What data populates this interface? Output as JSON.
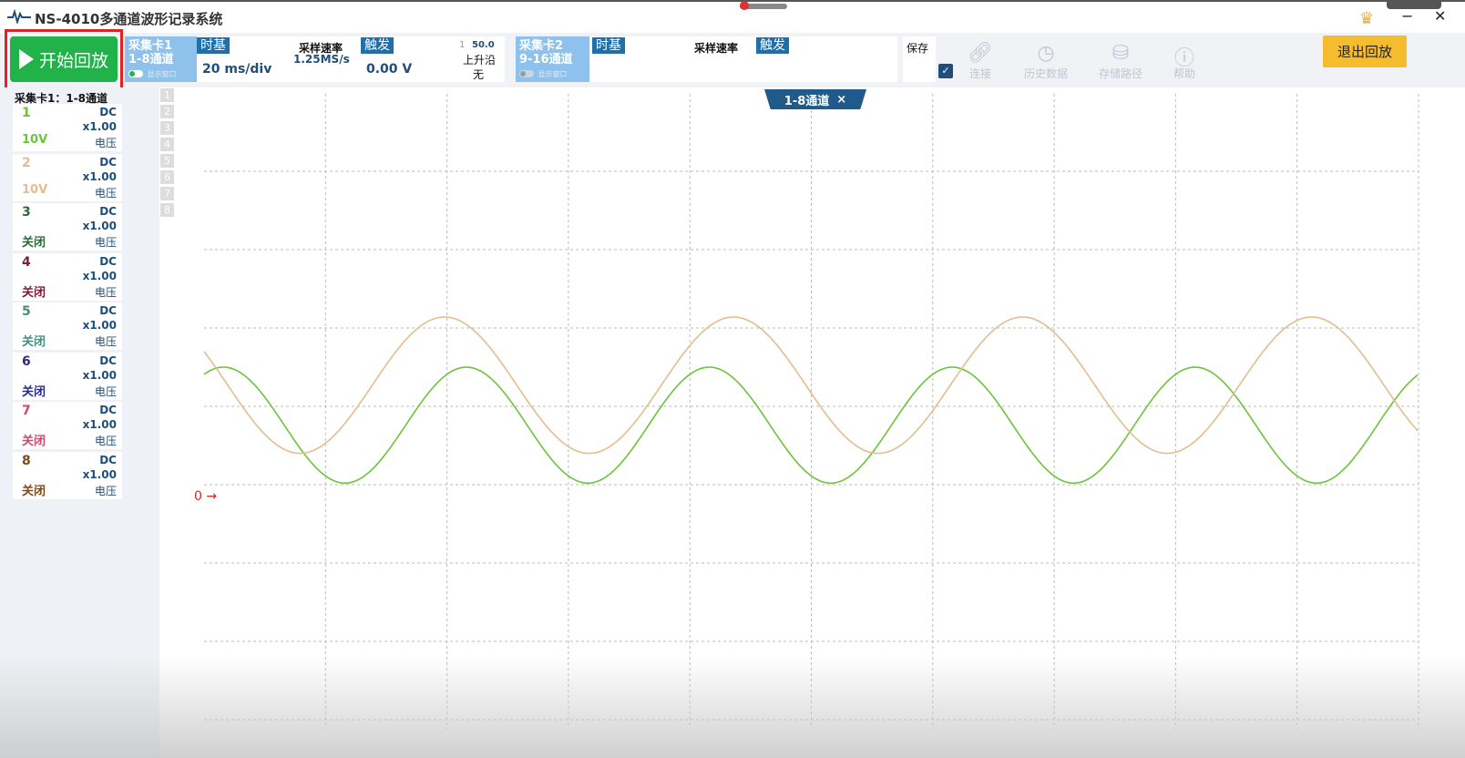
{
  "app": {
    "title": "NS-4010多通道波形记录系统"
  },
  "toolbar": {
    "play_label": "开始回放",
    "card1": {
      "name": "采集卡1",
      "channels": "1-8通道",
      "toggle_label": "显示窗口",
      "timebase_tag": "时基",
      "timebase_value": "20 ms/div",
      "sample_rate_label": "采样速率",
      "sample_rate_value": "1.25MS/s",
      "trigger_tag": "触发",
      "trigger_value": "0.00 V",
      "trigger_channel": "1",
      "trigger_level": "50.0",
      "trigger_edge": "上升沿",
      "trigger_mode": "无"
    },
    "card2": {
      "name": "采集卡2",
      "channels": "9-16通道",
      "toggle_label": "显示窗口",
      "timebase_tag": "时基",
      "sample_rate_label": "采样速率",
      "trigger_tag": "触发"
    },
    "save_label": "保存",
    "save_checked": true,
    "tools": [
      {
        "label": "连接",
        "icon": "link-icon"
      },
      {
        "label": "历史数据",
        "icon": "history-icon"
      },
      {
        "label": "存储路径",
        "icon": "storage-icon"
      },
      {
        "label": "帮助",
        "icon": "help-icon"
      }
    ],
    "exit_label": "退出回放"
  },
  "sidebar": {
    "title": "采集卡1：1-8通道",
    "channels": [
      {
        "num": "1",
        "coupling": "DC",
        "gain": "x1.00",
        "range": "10V",
        "type": "电压",
        "color": "#6cc43a"
      },
      {
        "num": "2",
        "coupling": "DC",
        "gain": "x1.00",
        "range": "10V",
        "type": "电压",
        "color": "#e2bd90"
      },
      {
        "num": "3",
        "coupling": "DC",
        "gain": "x1.00",
        "range": "关闭",
        "type": "电压",
        "color": "#2d6a3c"
      },
      {
        "num": "4",
        "coupling": "DC",
        "gain": "x1.00",
        "range": "关闭",
        "type": "电压",
        "color": "#7a1f35"
      },
      {
        "num": "5",
        "coupling": "DC",
        "gain": "x1.00",
        "range": "关闭",
        "type": "电压",
        "color": "#4a8c7c"
      },
      {
        "num": "6",
        "coupling": "DC",
        "gain": "x1.00",
        "range": "关闭",
        "type": "电压",
        "color": "#2c2c8c"
      },
      {
        "num": "7",
        "coupling": "DC",
        "gain": "x1.00",
        "range": "关闭",
        "type": "电压",
        "color": "#d3486a"
      },
      {
        "num": "8",
        "coupling": "DC",
        "gain": "x1.00",
        "range": "关闭",
        "type": "电压",
        "color": "#7a4a1c"
      }
    ],
    "channel_numbers": [
      "1",
      "2",
      "3",
      "4",
      "5",
      "6",
      "7",
      "8"
    ]
  },
  "plot": {
    "tab_label": "1-8通道",
    "close": "×",
    "zero_marker": "0 →",
    "waves": [
      {
        "channel": "1",
        "color": "#6cc43a",
        "period_div": 2.0,
        "amplitude_div": 0.74,
        "offset_div": 0.76,
        "peak_div": 0.16
      },
      {
        "channel": "2",
        "color": "#e2bd90",
        "period_div": 2.38,
        "amplitude_div": 0.87,
        "offset_div": 1.27,
        "peak_div": 1.98
      }
    ]
  }
}
